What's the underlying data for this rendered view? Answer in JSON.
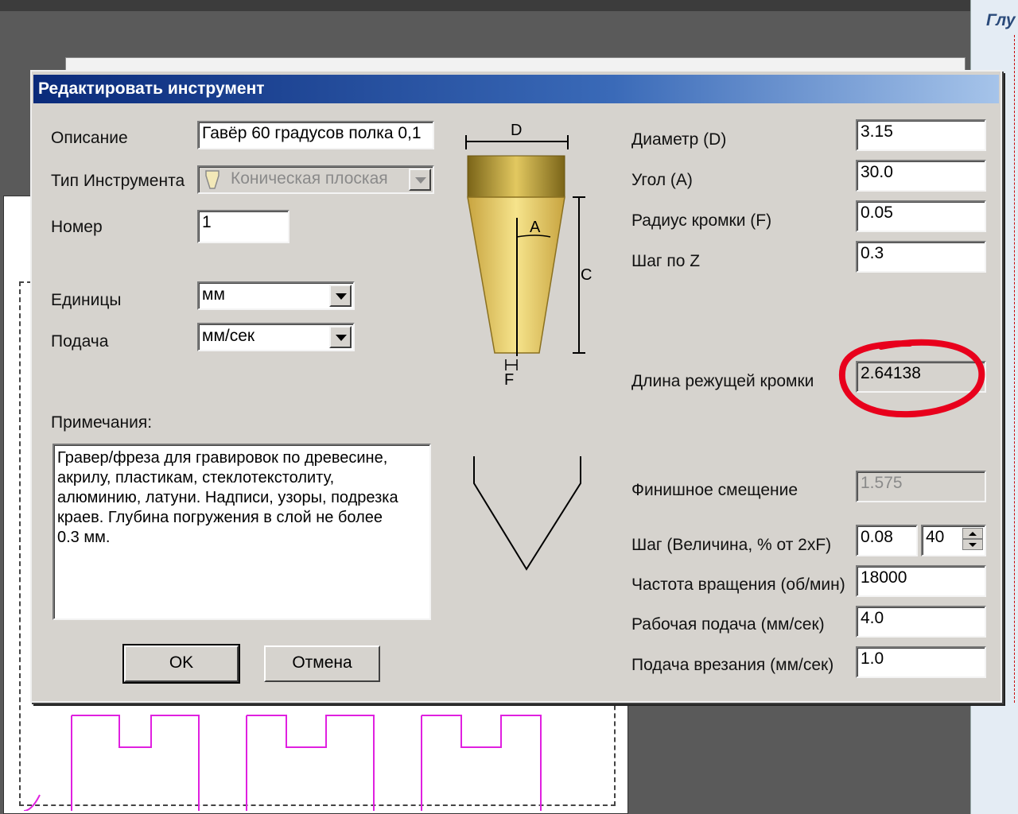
{
  "background": {
    "right_panel_label": "Глу"
  },
  "dialog": {
    "title": "Редактировать инструмент",
    "left": {
      "description_label": "Описание",
      "description_value": "Гавёр 60 градусов полка 0,1",
      "tool_type_label": "Тип Инструмента",
      "tool_type_value": "Коническая плоская",
      "number_label": "Номер",
      "number_value": "1",
      "units_label": "Единицы",
      "units_value": "мм",
      "feed_label": "Подача",
      "feed_value": "мм/сек",
      "notes_label": "Примечания:",
      "notes_value": "Гравер/фреза для гравировок по древесине,\nакрилу, пластикам, стеклотекстолиту,\nалюминию, латуни. Надписи, узоры, подрезка\nкраев. Глубина погружения в слой не более\n0.3 мм."
    },
    "diagram": {
      "label_d": "D",
      "label_a": "A",
      "label_c": "C",
      "label_f": "F",
      "bit_color": "#e8cf6a",
      "bit_top_color": "#a88a2a"
    },
    "right": {
      "diameter_label": "Диаметр (D)",
      "diameter_value": "3.15",
      "angle_label": "Угол (A)",
      "angle_value": "30.0",
      "edge_radius_label": "Радиус кромки (F)",
      "edge_radius_value": "0.05",
      "z_step_label": "Шаг по Z",
      "z_step_value": "0.3",
      "cutting_length_label": "Длина режущей кромки",
      "cutting_length_value": "2.64138",
      "finish_offset_label": "Финишное смещение",
      "finish_offset_value": "1.575",
      "stepover_label": "Шаг (Величина, % от 2xF)",
      "stepover_value": "0.08",
      "stepover_percent": "40",
      "spindle_label": "Частота вращения (об/мин)",
      "spindle_value": "18000",
      "work_feed_label": "Рабочая подача (мм/сек)",
      "work_feed_value": "4.0",
      "plunge_feed_label": "Подача врезания (мм/сек)",
      "plunge_feed_value": "1.0"
    },
    "buttons": {
      "ok_label": "OK",
      "cancel_label": "Отмена"
    },
    "annotation_color": "#e8001c"
  }
}
